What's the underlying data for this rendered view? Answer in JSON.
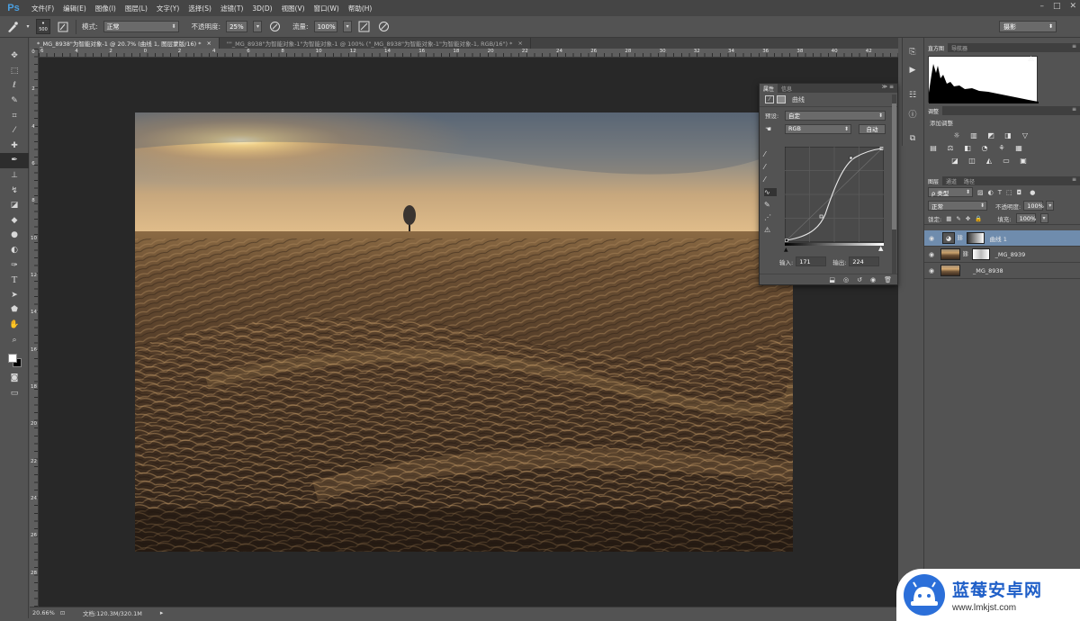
{
  "app": {
    "logo": "Ps"
  },
  "menu": [
    "文件(F)",
    "编辑(E)",
    "图像(I)",
    "图层(L)",
    "文字(Y)",
    "选择(S)",
    "滤镜(T)",
    "3D(D)",
    "视图(V)",
    "窗口(W)",
    "帮助(H)"
  ],
  "window_controls": [
    "–",
    "□",
    "✕"
  ],
  "options": {
    "brush_size": "500",
    "mode_label": "模式:",
    "mode_value": "正常",
    "opacity_label": "不透明度:",
    "opacity_value": "25%",
    "flow_label": "流量:",
    "flow_value": "100%",
    "workspace": "摄影"
  },
  "tabs": [
    "*_MG_8938\"为智能对象-1 @ 20.7% (曲线 1, 图层蒙版/16) *",
    "\"\"_MG_8938\"为智能对象-1\"为智能对象-1 @ 100% (\"_MG_8938\"为智能对象-1\"为智能对象-1, RGB/16\") *"
  ],
  "ruler_top": [
    "6",
    "4",
    "2",
    "0",
    "2",
    "4",
    "6",
    "8",
    "10",
    "12",
    "14",
    "16",
    "18",
    "20",
    "22",
    "24",
    "26",
    "28",
    "30",
    "32",
    "34",
    "36",
    "38",
    "40",
    "42"
  ],
  "ruler_left": [
    "0",
    "2",
    "4",
    "6",
    "8",
    "10",
    "12",
    "14",
    "16",
    "18",
    "20",
    "22",
    "24",
    "26",
    "28"
  ],
  "status": {
    "zoom": "20.66%",
    "doc": "文档:120.3M/320.1M"
  },
  "properties": {
    "tabs": [
      "属性",
      "信息"
    ],
    "title": "曲线",
    "preset_label": "预设:",
    "preset_value": "自定",
    "channel": "RGB",
    "auto_button": "自动",
    "input_label": "输入:",
    "input_value": "171",
    "output_label": "输出:",
    "output_value": "224"
  },
  "histogram": {
    "tabs": [
      "直方图",
      "导航器"
    ]
  },
  "adjustments": {
    "tabs": [
      "调整"
    ],
    "title": "添加调整"
  },
  "layers": {
    "tabs": [
      "图层",
      "通道",
      "路径"
    ],
    "filter_label": "ρ 类型",
    "blend": "正常",
    "opacity_label": "不透明度:",
    "opacity_value": "100%",
    "lock_label": "锁定:",
    "fill_label": "填充:",
    "fill_value": "100%",
    "items": [
      {
        "name": "曲线 1",
        "selected": true
      },
      {
        "name": "_MG_8939",
        "selected": false
      },
      {
        "name": "_MG_8938",
        "selected": false
      }
    ]
  },
  "watermark": {
    "title": "蓝莓安卓网",
    "url": "www.lmkjst.com"
  }
}
